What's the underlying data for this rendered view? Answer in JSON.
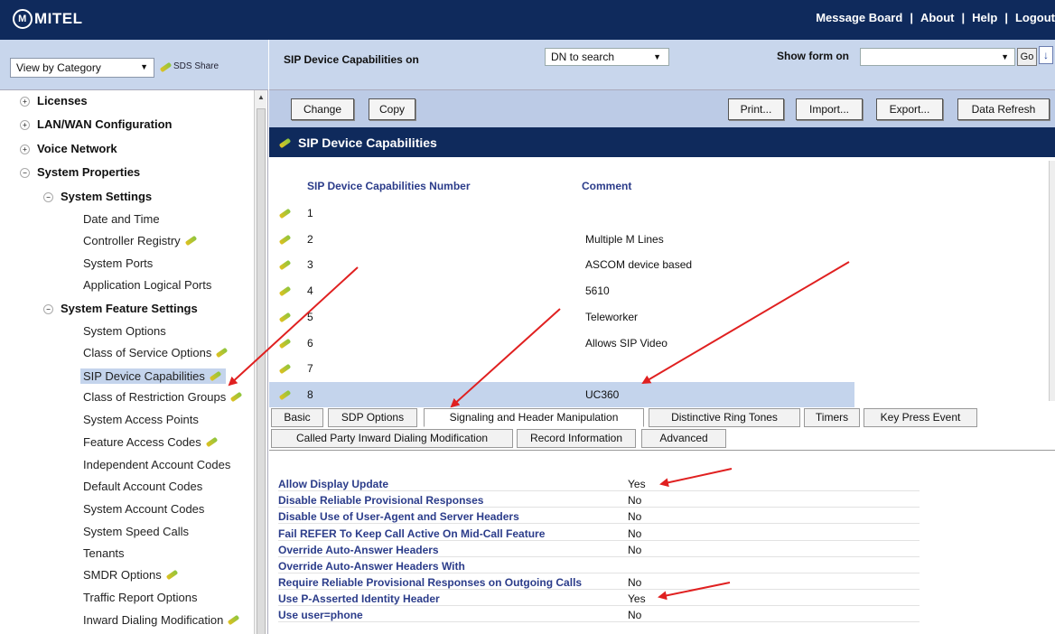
{
  "app": {
    "logo": "MITEL",
    "logo_mark": "M"
  },
  "top_links": [
    "Message Board",
    "About",
    "Help",
    "Logout"
  ],
  "left": {
    "view_select": "View by Category",
    "sds_share": "SDS Share",
    "tree": [
      {
        "label": "Licenses",
        "exp": "+"
      },
      {
        "label": "LAN/WAN Configuration",
        "exp": "+"
      },
      {
        "label": "Voice Network",
        "exp": "+"
      },
      {
        "label": "System Properties",
        "exp": "−"
      },
      {
        "label": "System Settings",
        "exp": "−"
      },
      {
        "label": "Date and Time"
      },
      {
        "label": "Controller Registry"
      },
      {
        "label": "System Ports"
      },
      {
        "label": "Application Logical Ports"
      },
      {
        "label": "System Feature Settings",
        "exp": "−"
      },
      {
        "label": "System Options"
      },
      {
        "label": "Class of Service Options"
      },
      {
        "label": "SIP Device Capabilities"
      },
      {
        "label": "Class of Restriction Groups"
      },
      {
        "label": "System Access Points"
      },
      {
        "label": "Feature Access Codes"
      },
      {
        "label": "Independent Account Codes"
      },
      {
        "label": "Default Account Codes"
      },
      {
        "label": "System Account Codes"
      },
      {
        "label": "System Speed Calls"
      },
      {
        "label": "Tenants"
      },
      {
        "label": "SMDR Options"
      },
      {
        "label": "Traffic Report Options"
      },
      {
        "label": "Inward Dialing Modification"
      }
    ]
  },
  "formbar": {
    "title": "SIP Device Capabilities on",
    "dn_select": "DN to search",
    "show_form_label": "Show form on",
    "go": "Go",
    "down_arrow": "↓"
  },
  "toolbar": {
    "change": "Change",
    "copy": "Copy",
    "print": "Print...",
    "import": "Import...",
    "export": "Export...",
    "refresh": "Data Refresh"
  },
  "section_title": "SIP Device Capabilities",
  "list": {
    "col_number": "SIP Device Capabilities Number",
    "col_comment": "Comment",
    "rows": [
      {
        "num": "1",
        "comment": ""
      },
      {
        "num": "2",
        "comment": "Multiple M Lines"
      },
      {
        "num": "3",
        "comment": "ASCOM device based"
      },
      {
        "num": "4",
        "comment": "5610"
      },
      {
        "num": "5",
        "comment": "Teleworker"
      },
      {
        "num": "6",
        "comment": "Allows SIP Video"
      },
      {
        "num": "7",
        "comment": ""
      },
      {
        "num": "8",
        "comment": "UC360"
      }
    ]
  },
  "tabs_row1": [
    "Basic",
    "SDP Options",
    "Signaling and Header Manipulation",
    "Distinctive Ring Tones",
    "Timers",
    "Key Press Event"
  ],
  "tabs_row2": [
    "Called Party Inward Dialing Modification",
    "Record Information",
    "Advanced"
  ],
  "details": [
    {
      "label": "Allow Display Update",
      "value": "Yes"
    },
    {
      "label": "Disable Reliable Provisional Responses",
      "value": "No"
    },
    {
      "label": "Disable Use of User-Agent and Server Headers",
      "value": "No"
    },
    {
      "label": "Fail REFER To Keep Call Active On Mid-Call Feature",
      "value": "No"
    },
    {
      "label": "Override Auto-Answer Headers",
      "value": "No"
    },
    {
      "label": "Override Auto-Answer Headers With",
      "value": ""
    },
    {
      "label": "Require Reliable Provisional Responses on Outgoing Calls",
      "value": "No"
    },
    {
      "label": "Use P-Asserted Identity Header",
      "value": "Yes"
    },
    {
      "label": "Use user=phone",
      "value": "No"
    }
  ],
  "colors": {
    "header_navy": "#0f2a5c",
    "panel_blue": "#c8d6ec",
    "selected": "#c4d4ec",
    "label_blue": "#2b3c8a",
    "annotation_red": "#e02020"
  }
}
